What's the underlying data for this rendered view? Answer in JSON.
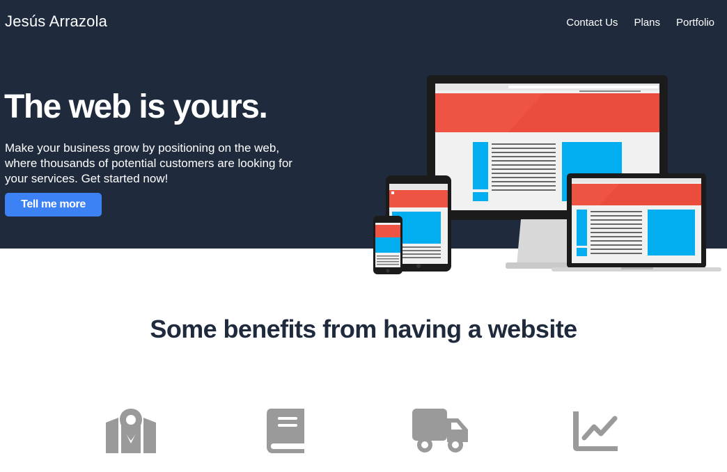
{
  "header": {
    "brand": "Jesús Arrazola",
    "nav": [
      "Contact Us",
      "Plans",
      "Portfolio"
    ]
  },
  "hero": {
    "headline": "The web is yours.",
    "lead": "Make your business grow by positioning on the web, where thousands of potential customers are looking for your services. Get started now!",
    "cta_label": "Tell me more"
  },
  "benefits": {
    "title": "Some benefits from having a website",
    "icons": [
      "map-marker-icon",
      "book-icon",
      "truck-icon",
      "line-chart-icon"
    ]
  },
  "colors": {
    "hero_bg": "#1f2a3c",
    "accent": "#3d82f5",
    "icon_gray": "#9a9a9a",
    "mock_red": "#ef5343",
    "mock_blue": "#02aeef"
  }
}
